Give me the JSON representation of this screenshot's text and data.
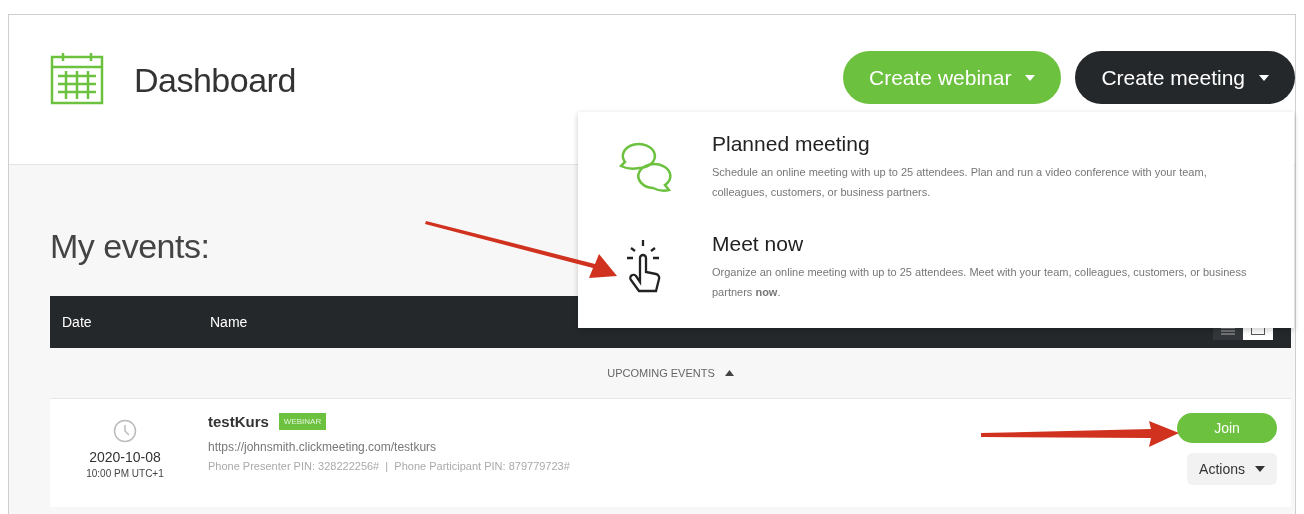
{
  "header": {
    "title": "Dashboard",
    "buttons": [
      {
        "label": "Create webinar",
        "kind": "green"
      },
      {
        "label": "Create meeting",
        "kind": "dark"
      }
    ]
  },
  "dropdown": {
    "items": [
      {
        "kind": "chat",
        "title": "Planned meeting",
        "description": "Schedule an online meeting with up to 25 attendees. Plan and run a video conference with your team, colleagues, customers, or business partners."
      },
      {
        "kind": "tap",
        "title": "Meet now",
        "description": "Organize an online meeting with up to 25 attendees. Meet with your team, colleagues, customers, or business partners **now**."
      }
    ]
  },
  "section_title": "My events:",
  "table": {
    "columns": [
      "Date",
      "Name"
    ],
    "group": {
      "label": "UPCOMING EVENTS",
      "expanded": true
    },
    "rows": [
      {
        "name": "testKurs",
        "badge": "WEBINAR",
        "url": "https://johnsmith.clickmeeting.com/testkurs",
        "pins": "Phone Presenter PIN: 328222256#  |  Phone Participant PIN: 879779723#",
        "date": "2020-10-08",
        "time": "10:00 PM UTC+1",
        "join": "Join",
        "actions": "Actions"
      }
    ]
  }
}
